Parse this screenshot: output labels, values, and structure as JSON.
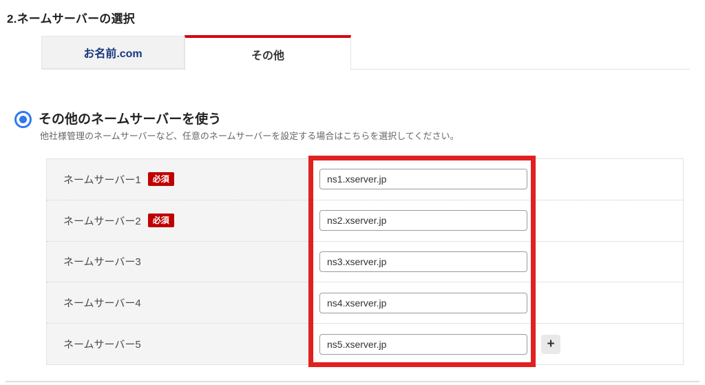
{
  "page": {
    "title": "2.ネームサーバーの選択"
  },
  "tabs": [
    {
      "label": "お名前.com",
      "active": false
    },
    {
      "label": "その他",
      "active": true
    }
  ],
  "radio_section": {
    "selected": true,
    "heading": "その他のネームサーバーを使う",
    "description": "他社様管理のネームサーバーなど、任意のネームサーバーを設定する場合はこちらを選択してください。"
  },
  "nameserver_table": {
    "rows": [
      {
        "label": "ネームサーバー1",
        "required": true,
        "badge": "必須",
        "value": "ns1.xserver.jp"
      },
      {
        "label": "ネームサーバー2",
        "required": true,
        "badge": "必須",
        "value": "ns2.xserver.jp"
      },
      {
        "label": "ネームサーバー3",
        "required": false,
        "badge": "",
        "value": "ns3.xserver.jp"
      },
      {
        "label": "ネームサーバー4",
        "required": false,
        "badge": "",
        "value": "ns4.xserver.jp"
      },
      {
        "label": "ネームサーバー5",
        "required": false,
        "badge": "",
        "value": "ns5.xserver.jp",
        "has_add_button": true
      }
    ],
    "add_button_label": "+"
  },
  "colors": {
    "active_tab_red": "#d7000f",
    "badge_red": "#c00000",
    "annotation_red": "#e0211f",
    "tab_text_blue": "#17377e",
    "radio_blue": "#3079ed"
  }
}
